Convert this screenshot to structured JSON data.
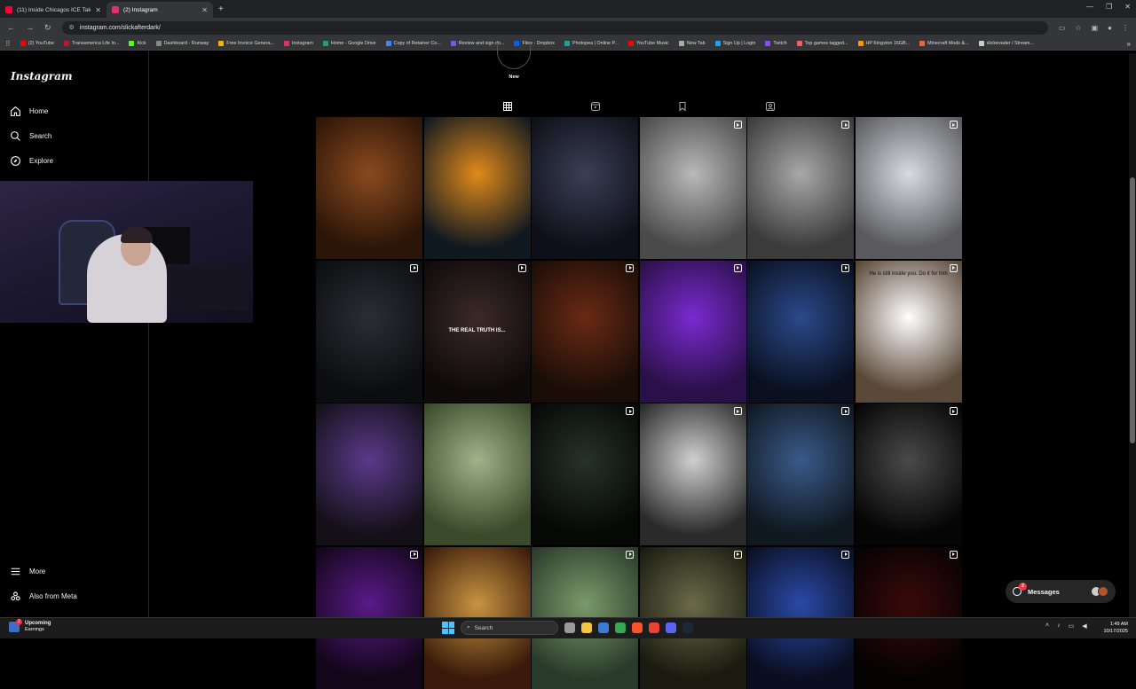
{
  "browser": {
    "tabs": [
      {
        "title": "(11) Inside Chicagos ICE Takeov...",
        "color": "#ff0033",
        "active": false
      },
      {
        "title": "(2) Instagram",
        "color": "#e1306c",
        "active": true
      }
    ],
    "url": "instagram.com/slickafterdark/",
    "bookmarks": [
      {
        "label": "(2) YouTube",
        "color": "#ff0000"
      },
      {
        "label": "Transamerica Life In...",
        "color": "#c8102e"
      },
      {
        "label": "Kick",
        "color": "#53fc18"
      },
      {
        "label": "Dashboard - Runway",
        "color": "#888888"
      },
      {
        "label": "Free Invoice Genera...",
        "color": "#f4b400"
      },
      {
        "label": "Instagram",
        "color": "#e1306c"
      },
      {
        "label": "Home - Google Drive",
        "color": "#1fa463"
      },
      {
        "label": "Copy of Retainer Co...",
        "color": "#4285f4"
      },
      {
        "label": "Review and sign do...",
        "color": "#6c5ce7"
      },
      {
        "label": "Files - Dropbox",
        "color": "#0061ff"
      },
      {
        "label": "Photopea | Online P...",
        "color": "#18a497"
      },
      {
        "label": "YouTube Music",
        "color": "#ff0000"
      },
      {
        "label": "New Tab",
        "color": "#aaaaaa"
      },
      {
        "label": "Sign Up | Login",
        "color": "#1da1f2"
      },
      {
        "label": "Twitch",
        "color": "#9146ff"
      },
      {
        "label": "Top games tagged...",
        "color": "#fa5c5c"
      },
      {
        "label": "HP Kingston 16GB...",
        "color": "#ff9900"
      },
      {
        "label": "Minecraft Mods &...",
        "color": "#f16436"
      },
      {
        "label": "slickevader / Stream...",
        "color": "#cccccc"
      }
    ]
  },
  "instagram": {
    "logo": "Instagram",
    "nav": [
      {
        "label": "Home",
        "icon": "home-icon"
      },
      {
        "label": "Search",
        "icon": "search-icon"
      },
      {
        "label": "Explore",
        "icon": "compass-icon"
      }
    ],
    "nav_bottom": [
      {
        "label": "More",
        "icon": "menu-icon"
      },
      {
        "label": "Also from Meta",
        "icon": "meta-icon"
      }
    ],
    "highlight_label": "New",
    "profile_tabs": [
      "posts-grid-icon",
      "reels-icon",
      "saved-icon",
      "tagged-icon"
    ],
    "messages": {
      "label": "Messages",
      "badge": "2"
    },
    "posts": [
      {
        "kind": "photo",
        "c1": "#8a4a1e",
        "c2": "#2b1508"
      },
      {
        "kind": "photo",
        "c1": "#e08a1a",
        "c2": "#101820"
      },
      {
        "kind": "photo",
        "c1": "#3a3f55",
        "c2": "#0e0f18"
      },
      {
        "kind": "reel",
        "c1": "#b9b9b9",
        "c2": "#4a4a4a"
      },
      {
        "kind": "reel",
        "c1": "#a8a8a8",
        "c2": "#3b3b3b"
      },
      {
        "kind": "reel",
        "c1": "#d8dbe0",
        "c2": "#5a5a5e"
      },
      {
        "kind": "reel",
        "c1": "#2a2e33",
        "c2": "#0c0d10"
      },
      {
        "kind": "reel",
        "c1": "#3a2a28",
        "c2": "#0f0a0a",
        "text": "THE REAL TRUTH IS..."
      },
      {
        "kind": "reel",
        "c1": "#6a2a14",
        "c2": "#1a0d08"
      },
      {
        "kind": "reel",
        "c1": "#7a2ad0",
        "c2": "#2a1048"
      },
      {
        "kind": "reel",
        "c1": "#2a4a8a",
        "c2": "#0a1020"
      },
      {
        "kind": "reel",
        "c1": "#ffffff",
        "c2": "#5a4838",
        "text": "He is still inside you. Do it for him"
      },
      {
        "kind": "photo",
        "c1": "#5a3a8a",
        "c2": "#141018"
      },
      {
        "kind": "photo",
        "c1": "#9fb38a",
        "c2": "#3b4a2a"
      },
      {
        "kind": "reel",
        "c1": "#26322a",
        "c2": "#060806"
      },
      {
        "kind": "reel",
        "c1": "#d0d0d0",
        "c2": "#2a2a2a"
      },
      {
        "kind": "reel",
        "c1": "#3a5a8a",
        "c2": "#101820"
      },
      {
        "kind": "reel",
        "c1": "#4a4a4a",
        "c2": "#050505"
      },
      {
        "kind": "reel",
        "c1": "#5a1a8a",
        "c2": "#120618"
      },
      {
        "kind": "photo",
        "c1": "#c89440",
        "c2": "#3a1a0a"
      },
      {
        "kind": "reel",
        "c1": "#7a9a6a",
        "c2": "#2a3a2a"
      },
      {
        "kind": "reel",
        "c1": "#6a6a4a",
        "c2": "#1a1a10"
      },
      {
        "kind": "reel",
        "c1": "#2a4aa8",
        "c2": "#0a0e20"
      },
      {
        "kind": "reel",
        "c1": "#3a0a0a",
        "c2": "#050202"
      }
    ]
  },
  "taskbar": {
    "weather_badge": "2",
    "weather_title": "Upcoming",
    "weather_sub": "Earnings",
    "search_placeholder": "Search",
    "apps": [
      {
        "name": "task-view-icon",
        "color": "#9a9a9a"
      },
      {
        "name": "file-explorer-icon",
        "color": "#f4c542"
      },
      {
        "name": "store-icon",
        "color": "#3a7bd5"
      },
      {
        "name": "chrome-icon",
        "color": "#34a853"
      },
      {
        "name": "brave-icon",
        "color": "#fb542b"
      },
      {
        "name": "chrome-profile-icon",
        "color": "#ea4335"
      },
      {
        "name": "discord-icon",
        "color": "#5865f2"
      },
      {
        "name": "steam-icon",
        "color": "#1b2838"
      }
    ],
    "time": "1:49 AM",
    "date": "10/17/2025"
  }
}
